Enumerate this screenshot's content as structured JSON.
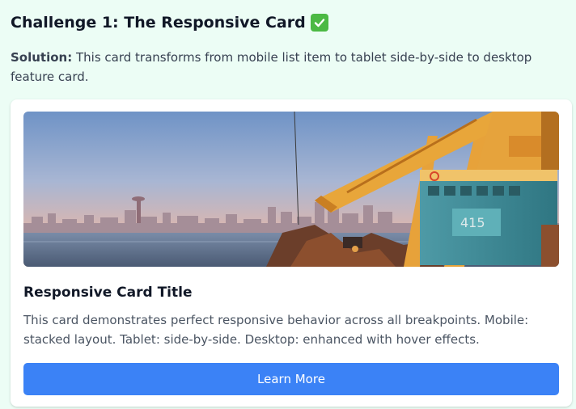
{
  "challenge": {
    "title": "Challenge 1: The Responsive Card",
    "icon": "check-mark-icon",
    "solution_label": "Solution:",
    "solution_text": " This card transforms from mobile list item to tablet side-by-side to desktop feature card."
  },
  "card": {
    "image_subject": "port crane over harbor with city skyline",
    "title": "Responsive Card Title",
    "description": "This card demonstrates perfect responsive behavior across all breakpoints. Mobile: stacked layout. Tablet: side-by-side. Desktop: enhanced with hover effects.",
    "button_label": "Learn More"
  },
  "colors": {
    "page_background": "#ecfdf5",
    "accent": "#3b82f6",
    "check": "#4cb944"
  }
}
